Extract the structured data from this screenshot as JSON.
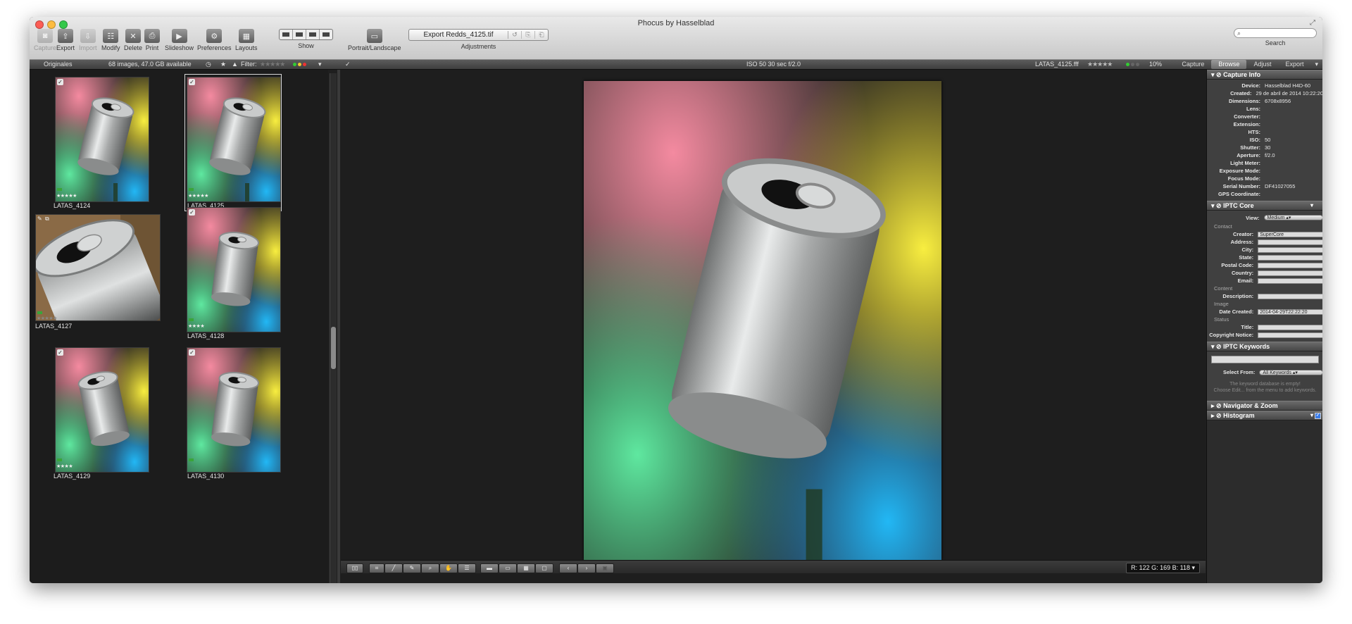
{
  "window": {
    "title": "Phocus by Hasselblad"
  },
  "toolbar": {
    "capture": "Capture",
    "export": "Export",
    "import": "Import",
    "modify": "Modify",
    "delete": "Delete",
    "print": "Print",
    "slideshow": "Slideshow",
    "preferences": "Preferences",
    "layouts": "Layouts",
    "show": "Show",
    "portrait_landscape": "Portrait/Landscape",
    "export_filename": "Export Redds_4125.tif",
    "adjustments": "Adjustments",
    "search_label": "Search",
    "search_placeholder": ""
  },
  "strip": {
    "folder": "Originales",
    "count": "68 images, 47.0 GB available",
    "filter_label": "Filter:",
    "exif": "ISO 50   30 sec   f/2.0",
    "current_file": "LATAS_4125.fff",
    "zoom": "10%",
    "tabs": [
      {
        "label": "Capture",
        "active": false
      },
      {
        "label": "Browse",
        "active": true
      },
      {
        "label": "Adjust",
        "active": false
      },
      {
        "label": "Export",
        "active": false
      }
    ]
  },
  "thumbnails": [
    {
      "name": "LATAS_4124",
      "stars": "★★★★★",
      "checked": true
    },
    {
      "name": "LATAS_4125",
      "stars": "★★★★★",
      "checked": true,
      "selected": true
    },
    {
      "name": "LATAS_4127",
      "stars": "★★★★★",
      "checked": false
    },
    {
      "name": "LATAS_4128",
      "stars": "★★★★",
      "checked": true
    },
    {
      "name": "LATAS_4129",
      "stars": "★★★★",
      "checked": true
    },
    {
      "name": "LATAS_4130",
      "stars": "",
      "checked": true
    }
  ],
  "viewer": {
    "rgb_readout": "R: 122  G: 169  B: 118"
  },
  "capture_info": {
    "title": "Capture Info",
    "rows": [
      {
        "k": "Device:",
        "v": "Hasselblad H4D-60"
      },
      {
        "k": "Created:",
        "v": "29 de abril de 2014 10:22:20"
      },
      {
        "k": "Dimensions:",
        "v": "6708x8956"
      },
      {
        "k": "Lens:",
        "v": ""
      },
      {
        "k": "Converter:",
        "v": ""
      },
      {
        "k": "Extension:",
        "v": ""
      },
      {
        "k": "HTS:",
        "v": ""
      },
      {
        "k": "ISO:",
        "v": "50"
      },
      {
        "k": "Shutter:",
        "v": "30"
      },
      {
        "k": "Aperture:",
        "v": "f/2.0"
      },
      {
        "k": "Light Meter:",
        "v": ""
      },
      {
        "k": "Exposure Mode:",
        "v": ""
      },
      {
        "k": "Focus Mode:",
        "v": ""
      },
      {
        "k": "Serial Number:",
        "v": "DF41027055"
      },
      {
        "k": "GPS Coordinate:",
        "v": ""
      }
    ]
  },
  "iptc_core": {
    "title": "IPTC Core",
    "view_label": "View:",
    "view_value": "Medium",
    "group_contact": "Contact",
    "group_content": "Content",
    "group_image": "Image",
    "group_status": "Status",
    "creator_label": "Creator:",
    "creator": "SuperCore",
    "address_label": "Address:",
    "city_label": "City:",
    "state_label": "State:",
    "postal_label": "Postal Code:",
    "country_label": "Country:",
    "email_label": "Email:",
    "description_label": "Description:",
    "date_label": "Date Created:",
    "date": "2014-04-29T22:22:20",
    "title_label": "Title:",
    "copyright_label": "Copyright Notice:"
  },
  "iptc_keywords": {
    "title": "IPTC Keywords",
    "select_label": "Select From:",
    "select_value": "All Keywords",
    "hint1": "The keyword database is empty!",
    "hint2": "Choose Edit... from the menu to add keywords."
  },
  "navigator": {
    "title": "Navigator & Zoom"
  },
  "histogram": {
    "title": "Histogram"
  }
}
